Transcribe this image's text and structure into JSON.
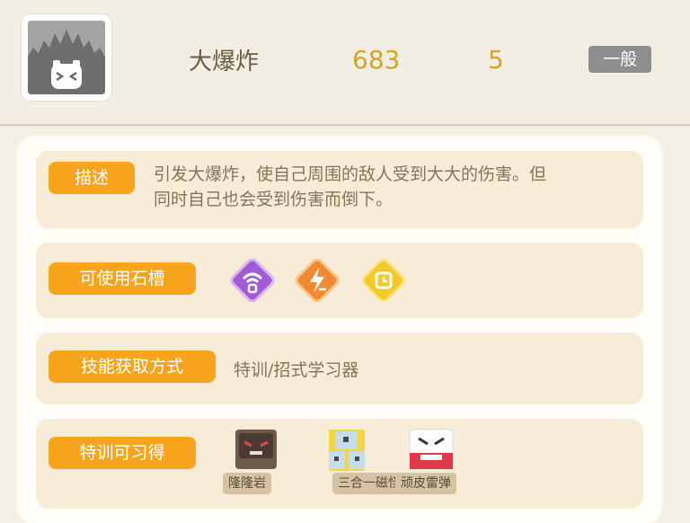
{
  "header": {
    "icon": "explosion-move-icon",
    "move_name": "大爆炸",
    "power": "683",
    "wait_time": "5",
    "type_label": "一般",
    "colors": {
      "type_badge": "#8f8f8f",
      "numbers": "#d4a32a"
    }
  },
  "description": {
    "label": "描述",
    "text_line1": "引发大爆炸，使自己周围的敌人受到大大的伤害。但",
    "text_line2": "同时自己也会受到伤害而倒下。"
  },
  "stone_slots": {
    "label": "可使用石槽",
    "slots": [
      {
        "icon": "wifi-slot-icon",
        "color": "#a35ad6"
      },
      {
        "icon": "lightning-slot-icon",
        "color": "#f08a33"
      },
      {
        "icon": "timer-slot-icon",
        "color": "#f2c92a"
      }
    ]
  },
  "acquire": {
    "label": "技能获取方式",
    "method": "特训/招式学习器"
  },
  "learners": {
    "label": "特训可习得",
    "pokemon": [
      {
        "name": "隆隆岩",
        "icon": "golem-icon"
      },
      {
        "name": "三合一磁怪",
        "icon": "magneton-icon"
      },
      {
        "name": "顽皮雷弹",
        "icon": "electrode-icon"
      }
    ]
  },
  "accent": "#f7a51c"
}
